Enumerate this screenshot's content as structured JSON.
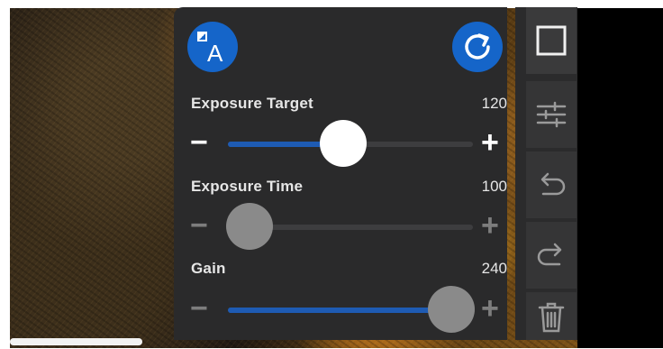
{
  "recording": {
    "progress": 1.0
  },
  "panel": {
    "auto_button": {
      "icon": "auto-exposure-icon",
      "letter": "A"
    },
    "reset_button": {
      "icon": "refresh-icon"
    },
    "sliders": [
      {
        "label": "Exposure Target",
        "value": "120",
        "position": 0.47,
        "active": true
      },
      {
        "label": "Exposure Time",
        "value": "100",
        "position": 0.09,
        "active": false
      },
      {
        "label": "Gain",
        "value": "240",
        "position": 0.91,
        "active": false
      }
    ]
  },
  "toolbar": {
    "items": [
      {
        "icon": "square-icon"
      },
      {
        "icon": "sliders-icon"
      },
      {
        "icon": "undo-icon"
      },
      {
        "icon": "redo-icon"
      },
      {
        "icon": "trash-icon"
      }
    ]
  },
  "colors": {
    "accent": "#1565c9",
    "slider_fill": "#1e5bb3",
    "panel": "#2a2a2b",
    "toolbar": "#2b2b2c"
  }
}
